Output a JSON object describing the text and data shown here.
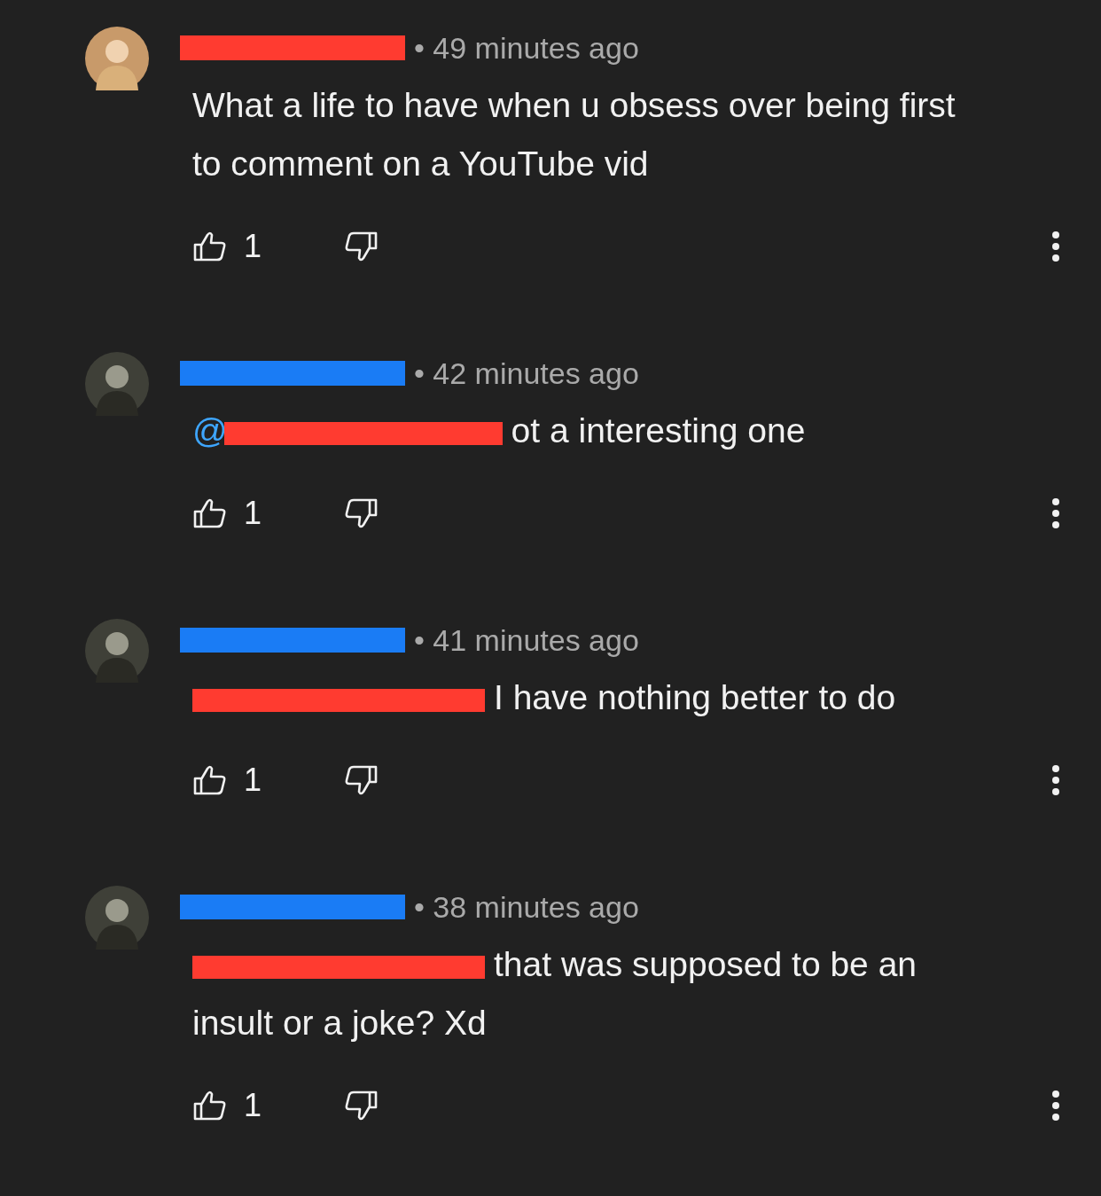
{
  "comments": [
    {
      "avatar": {
        "kind": "light"
      },
      "author_redaction": {
        "color": "#ff3b30"
      },
      "time": "• 49 minutes ago",
      "body": {
        "text": "What a life to have when u obsess over being first to comment on a YouTube vid"
      },
      "likes": "1"
    },
    {
      "avatar": {
        "kind": "dark"
      },
      "author_redaction": {
        "color": "#1a7cf5"
      },
      "time": "• 42 minutes ago",
      "body": {
        "mention": "@",
        "redaction": {
          "color": "#ff3b30"
        },
        "text": "ot a interesting one"
      },
      "likes": "1"
    },
    {
      "avatar": {
        "kind": "dark"
      },
      "author_redaction": {
        "color": "#1a7cf5"
      },
      "time": "• 41 minutes ago",
      "body": {
        "redaction": {
          "color": "#ff3b30"
        },
        "text": "I have nothing better to do"
      },
      "likes": "1"
    },
    {
      "avatar": {
        "kind": "dark"
      },
      "author_redaction": {
        "color": "#1a7cf5"
      },
      "time": "• 38 minutes ago",
      "body": {
        "redaction": {
          "color": "#ff3b30"
        },
        "text": "that was supposed to be an insult or a joke? Xd"
      },
      "likes": "1"
    }
  ]
}
